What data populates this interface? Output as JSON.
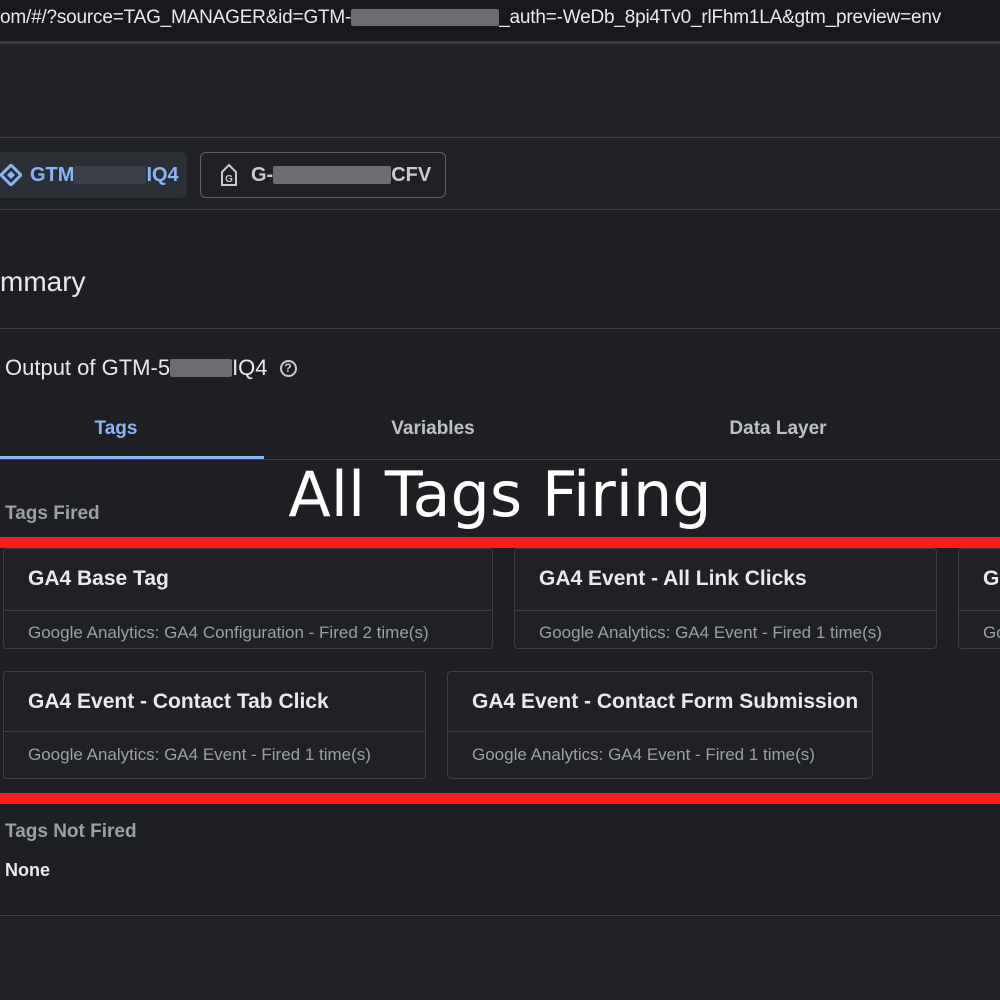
{
  "url": {
    "prefix": "om/#/?source=TAG_MANAGER&id=GTM-",
    "suffix": "_auth=-WeDb_8pi4Tv0_rlFhm1LA&gtm_preview=env"
  },
  "containers": [
    {
      "prefix": "GTM",
      "suffix": "IQ4",
      "icon": "gtm-diamond-icon"
    },
    {
      "prefix": "G-",
      "suffix": "CFV",
      "icon": "ga-tag-icon"
    }
  ],
  "summary": {
    "title": "mmary"
  },
  "output": {
    "prefix": "Output of GTM-5",
    "suffix": "IQ4",
    "icon": "help-icon"
  },
  "tabs": [
    {
      "label": "Tags",
      "active": true
    },
    {
      "label": "Variables",
      "active": false
    },
    {
      "label": "Data Layer",
      "active": false
    }
  ],
  "overlay": {
    "title": "All Tags Firing"
  },
  "tags_fired": {
    "label": "Tags Fired",
    "cards": [
      {
        "title": "GA4 Base Tag",
        "subtitle": "Google Analytics: GA4 Configuration - Fired 2 time(s)"
      },
      {
        "title": "GA4 Event - All Link Clicks",
        "subtitle": "Google Analytics: GA4 Event - Fired 1 time(s)"
      },
      {
        "title": "G",
        "subtitle": "Go"
      },
      {
        "title": "GA4 Event - Contact Tab Click",
        "subtitle": "Google Analytics: GA4 Event - Fired 1 time(s)"
      },
      {
        "title": "GA4 Event - Contact Form Submission",
        "subtitle": "Google Analytics: GA4 Event - Fired 1 time(s)"
      }
    ]
  },
  "tags_not_fired": {
    "label": "Tags Not Fired",
    "value": "None"
  },
  "colors": {
    "accent": "#8ab4f8",
    "highlight": "#ff1b1b",
    "background": "#202124"
  }
}
